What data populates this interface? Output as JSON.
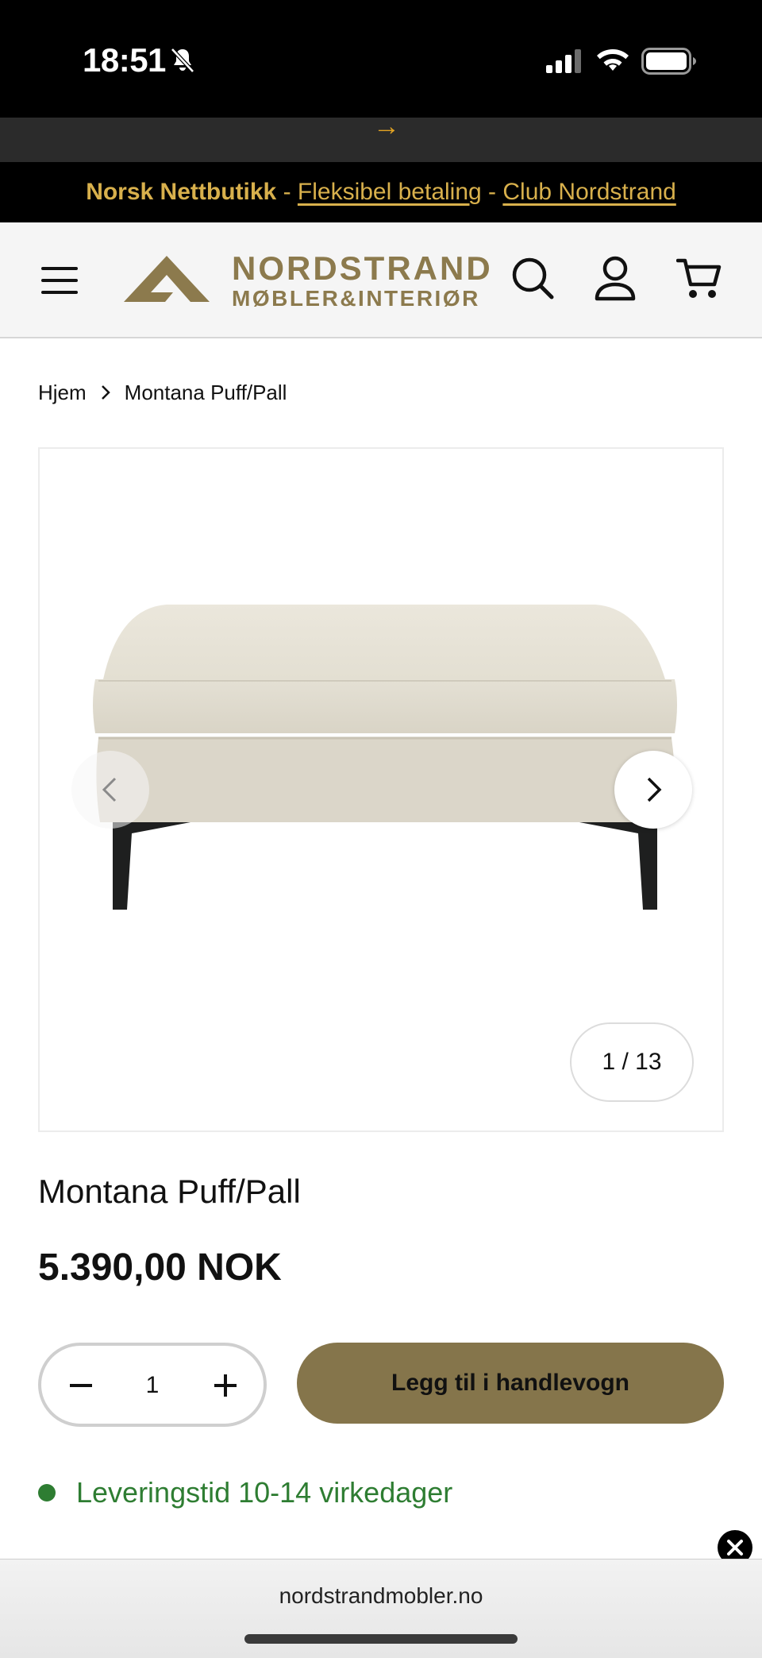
{
  "status_bar": {
    "time": "18:51"
  },
  "promo": {
    "arrow": "→"
  },
  "usp_bar": {
    "store_label": "Norsk Nettbutikk",
    "separator_1": " - ",
    "flexible_payment": "Fleksibel betaling",
    "separator_2": " - ",
    "club": "Club Nordstrand",
    "text_color": "#d8b04c"
  },
  "header": {
    "logo_line1": "NORDSTRAND",
    "logo_line2": "MØBLER&INTERIØR",
    "brand_color": "#8c7a4d",
    "icons": [
      "menu-icon",
      "search-icon",
      "account-icon",
      "cart-icon"
    ]
  },
  "breadcrumb": {
    "home": "Hjem",
    "current": "Montana Puff/Pall"
  },
  "gallery": {
    "counter": "1 / 13"
  },
  "product": {
    "title": "Montana Puff/Pall",
    "price": "5.390,00 NOK",
    "quantity": "1",
    "add_to_cart_label": "Legg til i handlevogn",
    "button_color": "#85754b",
    "delivery_text": "Leveringstid 10-14 virkedager",
    "delivery_color": "#2e7d32"
  },
  "browser": {
    "url": "nordstrandmobler.no"
  }
}
